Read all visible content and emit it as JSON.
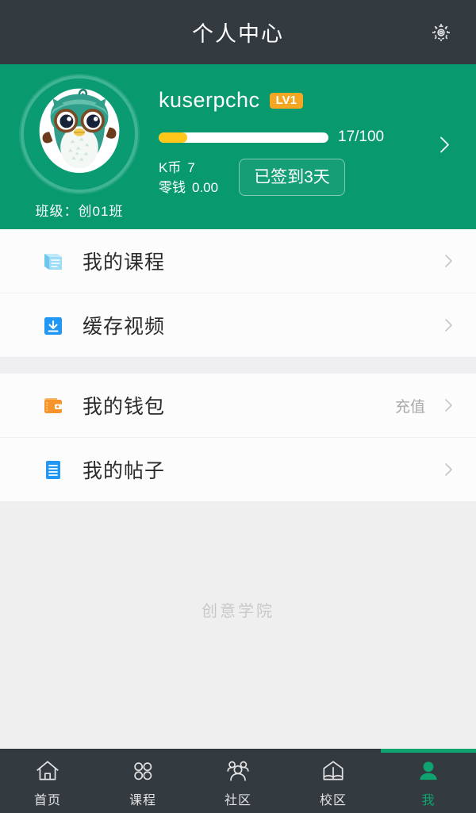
{
  "header": {
    "title": "个人中心",
    "settings_icon": "gear-icon"
  },
  "profile": {
    "avatar_icon": "owl-avatar",
    "class_label": "班级：创01班",
    "username": "kuserpchc",
    "level_badge": "LV1",
    "progress": {
      "current": 17,
      "max": 100,
      "text": "17/100",
      "percent": 17,
      "fill_color": "#ffc61a",
      "track_color": "#ffffff"
    },
    "stats": [
      {
        "label": "K币",
        "value": "7"
      },
      {
        "label": "零钱",
        "value": "0.00"
      }
    ],
    "signin_button": "已签到3天",
    "chevron_icon": "chevron-right-icon",
    "background_color": "#089a6e"
  },
  "menu_groups": [
    {
      "rows": [
        {
          "icon": "book-icon",
          "icon_color": "#4db8e8",
          "label": "我的课程",
          "extra": "",
          "chevron": "chevron-right-icon"
        },
        {
          "icon": "download-icon",
          "icon_color": "#2196f3",
          "label": "缓存视频",
          "extra": "",
          "chevron": "chevron-right-icon"
        }
      ]
    },
    {
      "rows": [
        {
          "icon": "wallet-icon",
          "icon_color": "#f5942a",
          "label": "我的钱包",
          "extra": "充值",
          "chevron": "chevron-right-icon"
        },
        {
          "icon": "document-icon",
          "icon_color": "#2196f3",
          "label": "我的帖子",
          "extra": "",
          "chevron": "chevron-right-icon"
        }
      ]
    }
  ],
  "watermark": "创意学院",
  "tabbar": {
    "active_color": "#0fa46f",
    "inactive_color": "#e3e3e3",
    "items": [
      {
        "icon": "home-icon",
        "label": "首页",
        "active": false
      },
      {
        "icon": "grid-icon",
        "label": "课程",
        "active": false
      },
      {
        "icon": "people-icon",
        "label": "社区",
        "active": false
      },
      {
        "icon": "campus-book-icon",
        "label": "校区",
        "active": false
      },
      {
        "icon": "person-icon",
        "label": "我",
        "active": true
      }
    ]
  }
}
